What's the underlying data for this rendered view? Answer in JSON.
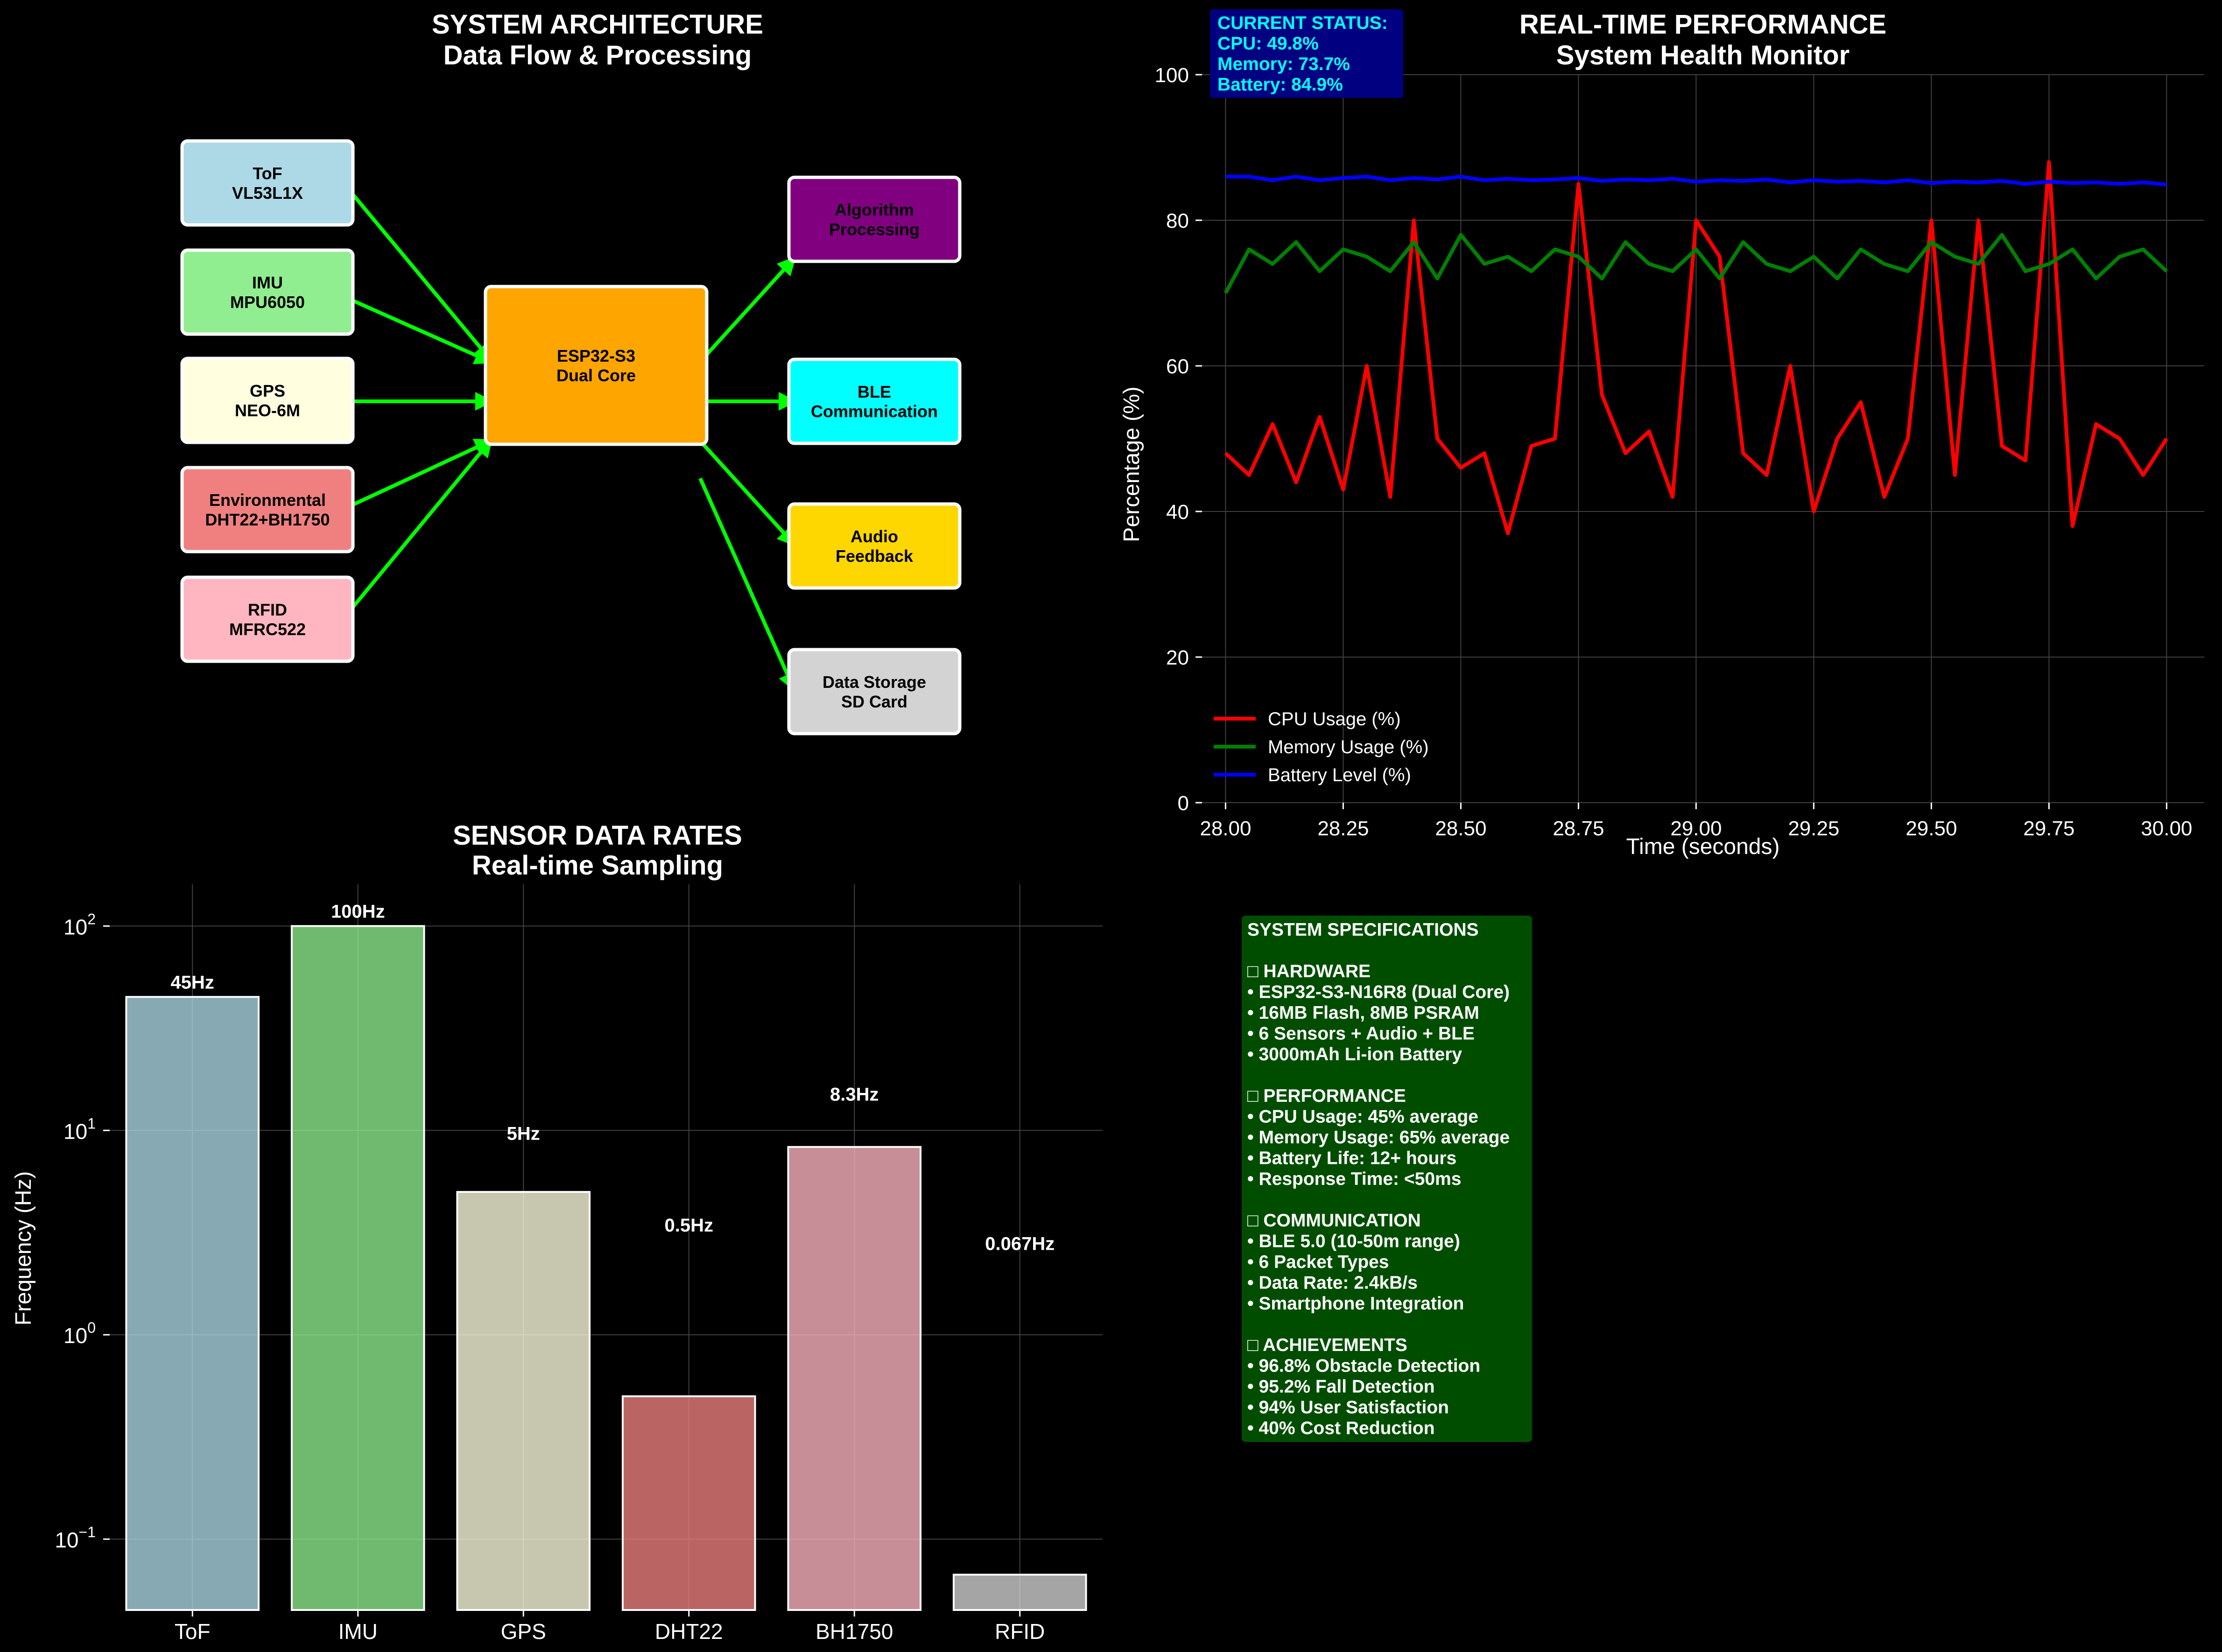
{
  "arch": {
    "title": "SYSTEM ARCHITECTURE",
    "subtitle": "Data Flow & Processing",
    "inputs": [
      {
        "line1": "ToF",
        "line2": "VL53L1X",
        "color": "#add8e6"
      },
      {
        "line1": "IMU",
        "line2": "MPU6050",
        "color": "#90ee90"
      },
      {
        "line1": "GPS",
        "line2": "NEO-6M",
        "color": "#ffffe0"
      },
      {
        "line1": "Environmental",
        "line2": "DHT22+BH1750",
        "color": "#f08080"
      },
      {
        "line1": "RFID",
        "line2": "MFRC522",
        "color": "#ffb6c1"
      }
    ],
    "core": {
      "line1": "ESP32-S3",
      "line2": "Dual Core",
      "color": "#ffa500"
    },
    "outputs": [
      {
        "line1": "Algorithm",
        "line2": "Processing",
        "color": "#800080"
      },
      {
        "line1": "BLE",
        "line2": "Communication",
        "color": "#00ffff"
      },
      {
        "line1": "Audio",
        "line2": "Feedback",
        "color": "#ffd700"
      },
      {
        "line1": "Data Storage",
        "line2": "SD Card",
        "color": "#d3d3d3"
      }
    ],
    "arrow_color": "#00ff00"
  },
  "perf": {
    "title": "REAL-TIME PERFORMANCE",
    "subtitle": "System Health Monitor",
    "status_lines": [
      "CURRENT STATUS:",
      "CPU: 49.8%",
      "Memory: 73.7%",
      "Battery: 84.9%"
    ]
  },
  "rates": {
    "title": "SENSOR DATA RATES",
    "subtitle": "Real-time Sampling"
  },
  "specs": {
    "lines": [
      "SYSTEM SPECIFICATIONS",
      "",
      "□ HARDWARE",
      "• ESP32-S3-N16R8 (Dual Core)",
      "• 16MB Flash, 8MB PSRAM",
      "• 6 Sensors + Audio + BLE",
      "• 3000mAh Li-ion Battery",
      "",
      "□ PERFORMANCE",
      "• CPU Usage: 45% average",
      "• Memory Usage: 65% average",
      "• Battery Life: 12+ hours",
      "• Response Time: <50ms",
      "",
      "□ COMMUNICATION",
      "• BLE 5.0 (10-50m range)",
      "• 6 Packet Types",
      "• Data Rate: 2.4kB/s",
      "• Smartphone Integration",
      "",
      "□ ACHIEVEMENTS",
      "• 96.8% Obstacle Detection",
      "• 95.2% Fall Detection",
      "• 94% User Satisfaction",
      "• 40% Cost Reduction"
    ],
    "bg_color": "#004d00"
  },
  "chart_data": [
    {
      "type": "line",
      "title": "REAL-TIME PERFORMANCE",
      "subtitle": "System Health Monitor",
      "xlabel": "Time (seconds)",
      "ylabel": "Percentage (%)",
      "xlim": [
        27.95,
        30.08
      ],
      "ylim": [
        0,
        100
      ],
      "xticks": [
        28.0,
        28.25,
        28.5,
        28.75,
        29.0,
        29.25,
        29.5,
        29.75,
        30.0
      ],
      "xtick_labels": [
        "28.00",
        "28.25",
        "28.50",
        "28.75",
        "29.00",
        "29.25",
        "29.50",
        "29.75",
        "30.00"
      ],
      "yticks": [
        0,
        20,
        40,
        60,
        80,
        100
      ],
      "grid": true,
      "legend_position": "lower-left",
      "x": [
        28.0,
        28.05,
        28.1,
        28.15,
        28.2,
        28.25,
        28.3,
        28.35,
        28.4,
        28.45,
        28.5,
        28.55,
        28.6,
        28.65,
        28.7,
        28.75,
        28.8,
        28.85,
        28.9,
        28.95,
        29.0,
        29.05,
        29.1,
        29.15,
        29.2,
        29.25,
        29.3,
        29.35,
        29.4,
        29.45,
        29.5,
        29.55,
        29.6,
        29.65,
        29.7,
        29.75,
        29.8,
        29.85,
        29.9,
        29.95,
        30.0
      ],
      "series": [
        {
          "name": "CPU Usage (%)",
          "color": "#ff0000",
          "values": [
            48,
            45,
            52,
            44,
            53,
            43,
            60,
            42,
            80,
            50,
            46,
            48,
            37,
            49,
            50,
            85,
            56,
            48,
            51,
            42,
            80,
            75,
            48,
            45,
            60,
            40,
            50,
            55,
            42,
            50,
            80,
            45,
            80,
            49,
            47,
            88,
            38,
            52,
            50,
            45,
            50
          ]
        },
        {
          "name": "Memory Usage (%)",
          "color": "#008000",
          "values": [
            70,
            76,
            74,
            77,
            73,
            76,
            75,
            73,
            77,
            72,
            78,
            74,
            75,
            73,
            76,
            75,
            72,
            77,
            74,
            73,
            76,
            72,
            77,
            74,
            73,
            75,
            72,
            76,
            74,
            73,
            77,
            75,
            74,
            78,
            73,
            74,
            76,
            72,
            75,
            76,
            73
          ]
        },
        {
          "name": "Battery Level (%)",
          "color": "#0000ff",
          "values": [
            86,
            86,
            85.5,
            86,
            85.5,
            85.8,
            86,
            85.5,
            85.8,
            85.6,
            86,
            85.5,
            85.7,
            85.5,
            85.6,
            85.8,
            85.4,
            85.6,
            85.5,
            85.7,
            85.3,
            85.5,
            85.4,
            85.6,
            85.2,
            85.5,
            85.3,
            85.4,
            85.2,
            85.5,
            85.1,
            85.3,
            85.2,
            85.4,
            85,
            85.3,
            85.1,
            85.2,
            85,
            85.2,
            84.9
          ]
        }
      ]
    },
    {
      "type": "bar",
      "title": "SENSOR DATA RATES",
      "subtitle": "Real-time Sampling",
      "xlabel": "",
      "ylabel": "Frequency (Hz)",
      "yscale": "log",
      "ylim": [
        0.045,
        160
      ],
      "ytick_values": [
        0.1,
        1,
        10,
        100
      ],
      "ytick_labels": [
        {
          "base": "10",
          "exp": "−1"
        },
        {
          "base": "10",
          "exp": "0"
        },
        {
          "base": "10",
          "exp": "1"
        },
        {
          "base": "10",
          "exp": "2"
        }
      ],
      "grid": true,
      "categories": [
        "ToF",
        "IMU",
        "GPS",
        "DHT22",
        "BH1750",
        "RFID"
      ],
      "values": [
        45,
        100,
        5,
        0.5,
        8.3,
        0.067
      ],
      "value_labels": [
        "45Hz",
        "100Hz",
        "5Hz",
        "0.5Hz",
        "8.3Hz",
        "0.067Hz"
      ],
      "colors": [
        "#add8e6",
        "#90ee90",
        "#ffffe0",
        "#f08080",
        "#ffb6c1",
        "#d3d3d3"
      ]
    }
  ]
}
